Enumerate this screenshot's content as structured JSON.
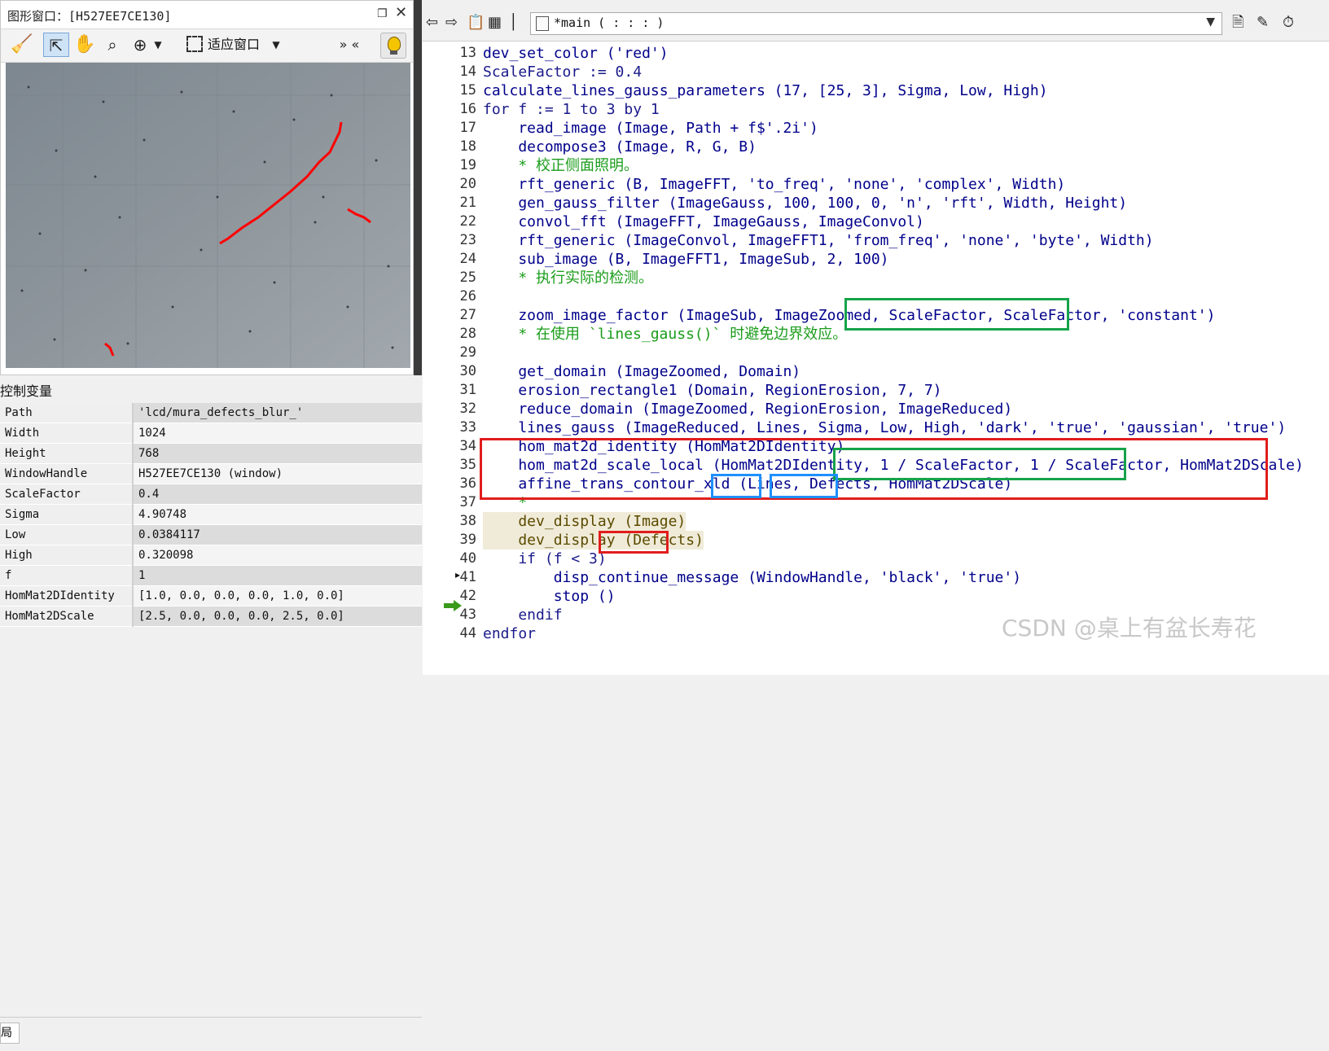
{
  "graphics_window": {
    "title": "图形窗口：[H527EE7CE130]",
    "toolbar": {
      "fit_label": "适应窗口",
      "more_label": "» «"
    }
  },
  "control_vars": {
    "title": "控制变量",
    "rows": [
      {
        "name": "Path",
        "value": "'lcd/mura_defects_blur_'"
      },
      {
        "name": "Width",
        "value": "1024"
      },
      {
        "name": "Height",
        "value": "768"
      },
      {
        "name": "WindowHandle",
        "value": "H527EE7CE130 (window)"
      },
      {
        "name": "ScaleFactor",
        "value": "0.4"
      },
      {
        "name": "Sigma",
        "value": "4.90748"
      },
      {
        "name": "Low",
        "value": "0.0384117"
      },
      {
        "name": "High",
        "value": "0.320098"
      },
      {
        "name": "f",
        "value": "1"
      },
      {
        "name": "HomMat2DIdentity",
        "value": "[1.0, 0.0, 0.0, 0.0, 1.0, 0.0]"
      },
      {
        "name": "HomMat2DScale",
        "value": "[2.5, 0.0, 0.0, 0.0, 2.5, 0.0]"
      }
    ],
    "bottom_tab": "局"
  },
  "program_window": {
    "combo_text": "*main ( : : : )",
    "lines": [
      {
        "n": "13",
        "text": "dev_set_color ('red')",
        "kind": "op"
      },
      {
        "n": "14",
        "text": "ScaleFactor := 0.4",
        "kind": "dk"
      },
      {
        "n": "15",
        "text": "calculate_lines_gauss_parameters (17, [25, 3], Sigma, Low, High)",
        "kind": "op"
      },
      {
        "n": "16",
        "text": "for f := 1 to 3 by 1",
        "kind": "dk"
      },
      {
        "n": "17",
        "text": "    read_image (Image, Path + f$'.2i')",
        "kind": "op"
      },
      {
        "n": "18",
        "text": "    decompose3 (Image, R, G, B)",
        "kind": "op"
      },
      {
        "n": "19",
        "text": "    * 校正侧面照明。",
        "kind": "cm"
      },
      {
        "n": "20",
        "text": "    rft_generic (B, ImageFFT, 'to_freq', 'none', 'complex', Width)",
        "kind": "op"
      },
      {
        "n": "21",
        "text": "    gen_gauss_filter (ImageGauss, 100, 100, 0, 'n', 'rft', Width, Height)",
        "kind": "op"
      },
      {
        "n": "22",
        "text": "    convol_fft (ImageFFT, ImageGauss, ImageConvol)",
        "kind": "op"
      },
      {
        "n": "23",
        "text": "    rft_generic (ImageConvol, ImageFFT1, 'from_freq', 'none', 'byte', Width)",
        "kind": "op"
      },
      {
        "n": "24",
        "text": "    sub_image (B, ImageFFT1, ImageSub, 2, 100)",
        "kind": "op"
      },
      {
        "n": "25",
        "text": "    * 执行实际的检测。",
        "kind": "cm"
      },
      {
        "n": "26",
        "text": "",
        "kind": "op"
      },
      {
        "n": "27",
        "text": "    zoom_image_factor (ImageSub, ImageZoomed, ScaleFactor, ScaleFactor, 'constant')",
        "kind": "op"
      },
      {
        "n": "28",
        "text": "    * 在使用 `lines_gauss()` 时避免边界效应。",
        "kind": "cm"
      },
      {
        "n": "29",
        "text": "",
        "kind": "op"
      },
      {
        "n": "30",
        "text": "    get_domain (ImageZoomed, Domain)",
        "kind": "op"
      },
      {
        "n": "31",
        "text": "    erosion_rectangle1 (Domain, RegionErosion, 7, 7)",
        "kind": "op"
      },
      {
        "n": "32",
        "text": "    reduce_domain (ImageZoomed, RegionErosion, ImageReduced)",
        "kind": "op"
      },
      {
        "n": "33",
        "text": "    lines_gauss (ImageReduced, Lines, Sigma, Low, High, 'dark', 'true', 'gaussian', 'true')",
        "kind": "op"
      },
      {
        "n": "34",
        "text": "    hom_mat2d_identity (HomMat2DIdentity)",
        "kind": "op"
      },
      {
        "n": "35",
        "text": "    hom_mat2d_scale_local (HomMat2DIdentity, 1 / ScaleFactor, 1 / ScaleFactor, HomMat2DScale)",
        "kind": "op"
      },
      {
        "n": "36",
        "text": "    affine_trans_contour_xld (Lines, Defects, HomMat2DScale)",
        "kind": "op"
      },
      {
        "n": "37",
        "text": "    *",
        "kind": "cm"
      },
      {
        "n": "38",
        "text": "    dev_display (Image)",
        "kind": "dd2"
      },
      {
        "n": "39",
        "text": "    dev_display (Defects)",
        "kind": "dd2"
      },
      {
        "n": "40",
        "text": "    if (f < 3)",
        "kind": "dk"
      },
      {
        "n": "41",
        "text": "        disp_continue_message (WindowHandle, 'black', 'true')",
        "kind": "op"
      },
      {
        "n": "42",
        "text": "        stop ()",
        "kind": "op"
      },
      {
        "n": "43",
        "text": "    endif",
        "kind": "dk"
      },
      {
        "n": "44",
        "text": "endfor",
        "kind": "dk"
      }
    ]
  },
  "watermark": "CSDN @桌上有盆长寿花",
  "colors": {
    "green_box": "#16a34a",
    "red_box": "#e11d1d",
    "blue_box": "#1e90ff",
    "defect_red": "#ff0000"
  }
}
